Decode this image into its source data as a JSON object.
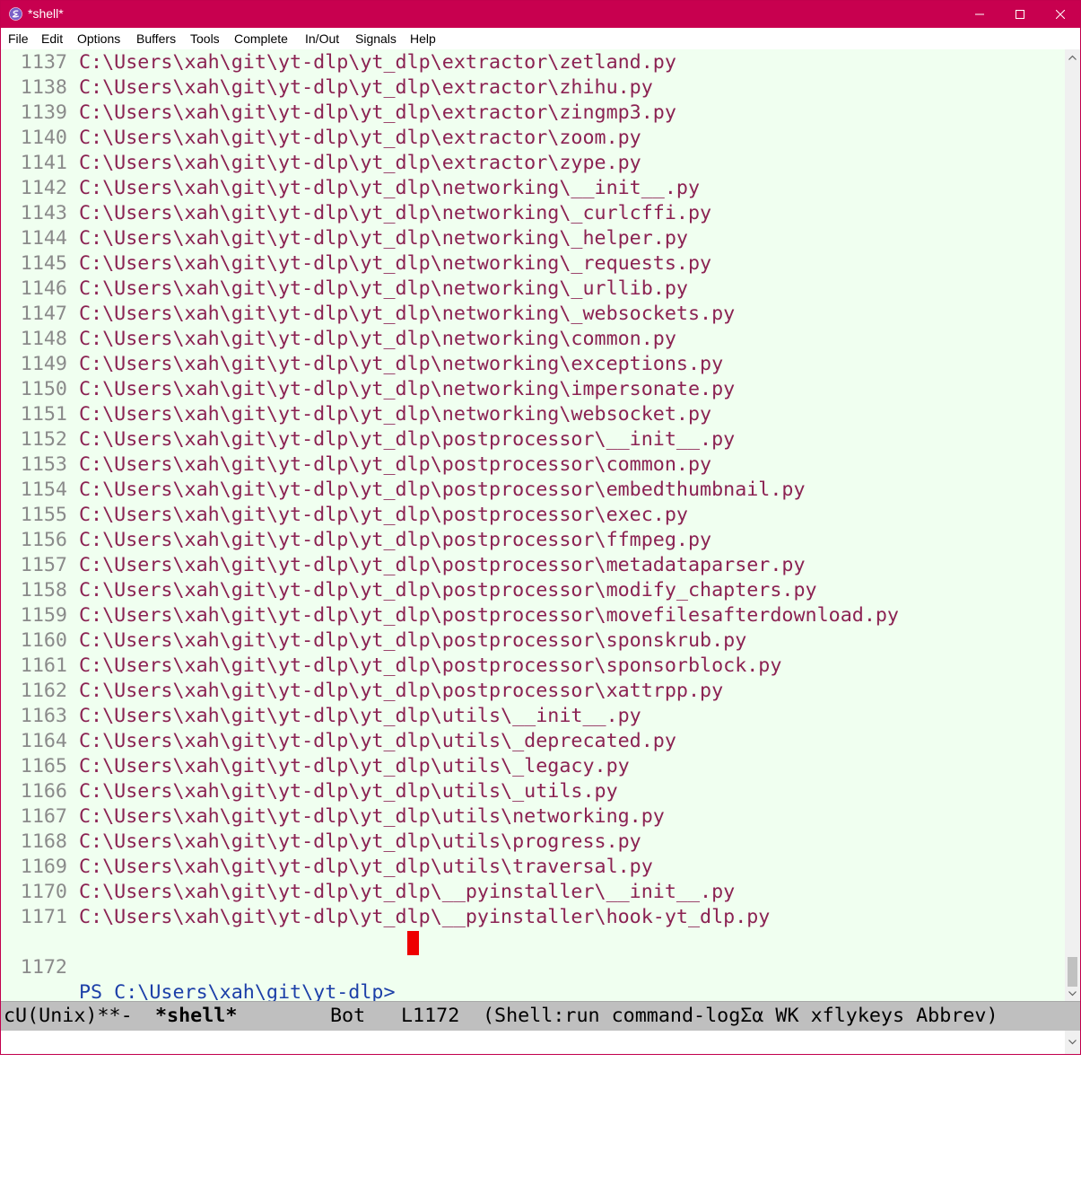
{
  "window": {
    "title": "*shell*",
    "accent": "#c8004f"
  },
  "menu": [
    "File",
    "Edit",
    "Options",
    "Buffers",
    "Tools",
    "Complete",
    "In/Out",
    "Signals",
    "Help"
  ],
  "buffer": {
    "lines": [
      {
        "n": "1137",
        "text": "C:\\Users\\xah\\git\\yt-dlp\\yt_dlp\\extractor\\zetland.py"
      },
      {
        "n": "1138",
        "text": "C:\\Users\\xah\\git\\yt-dlp\\yt_dlp\\extractor\\zhihu.py"
      },
      {
        "n": "1139",
        "text": "C:\\Users\\xah\\git\\yt-dlp\\yt_dlp\\extractor\\zingmp3.py"
      },
      {
        "n": "1140",
        "text": "C:\\Users\\xah\\git\\yt-dlp\\yt_dlp\\extractor\\zoom.py"
      },
      {
        "n": "1141",
        "text": "C:\\Users\\xah\\git\\yt-dlp\\yt_dlp\\extractor\\zype.py"
      },
      {
        "n": "1142",
        "text": "C:\\Users\\xah\\git\\yt-dlp\\yt_dlp\\networking\\__init__.py"
      },
      {
        "n": "1143",
        "text": "C:\\Users\\xah\\git\\yt-dlp\\yt_dlp\\networking\\_curlcffi.py"
      },
      {
        "n": "1144",
        "text": "C:\\Users\\xah\\git\\yt-dlp\\yt_dlp\\networking\\_helper.py"
      },
      {
        "n": "1145",
        "text": "C:\\Users\\xah\\git\\yt-dlp\\yt_dlp\\networking\\_requests.py"
      },
      {
        "n": "1146",
        "text": "C:\\Users\\xah\\git\\yt-dlp\\yt_dlp\\networking\\_urllib.py"
      },
      {
        "n": "1147",
        "text": "C:\\Users\\xah\\git\\yt-dlp\\yt_dlp\\networking\\_websockets.py"
      },
      {
        "n": "1148",
        "text": "C:\\Users\\xah\\git\\yt-dlp\\yt_dlp\\networking\\common.py"
      },
      {
        "n": "1149",
        "text": "C:\\Users\\xah\\git\\yt-dlp\\yt_dlp\\networking\\exceptions.py"
      },
      {
        "n": "1150",
        "text": "C:\\Users\\xah\\git\\yt-dlp\\yt_dlp\\networking\\impersonate.py"
      },
      {
        "n": "1151",
        "text": "C:\\Users\\xah\\git\\yt-dlp\\yt_dlp\\networking\\websocket.py"
      },
      {
        "n": "1152",
        "text": "C:\\Users\\xah\\git\\yt-dlp\\yt_dlp\\postprocessor\\__init__.py"
      },
      {
        "n": "1153",
        "text": "C:\\Users\\xah\\git\\yt-dlp\\yt_dlp\\postprocessor\\common.py"
      },
      {
        "n": "1154",
        "text": "C:\\Users\\xah\\git\\yt-dlp\\yt_dlp\\postprocessor\\embedthumbnail.py"
      },
      {
        "n": "1155",
        "text": "C:\\Users\\xah\\git\\yt-dlp\\yt_dlp\\postprocessor\\exec.py"
      },
      {
        "n": "1156",
        "text": "C:\\Users\\xah\\git\\yt-dlp\\yt_dlp\\postprocessor\\ffmpeg.py"
      },
      {
        "n": "1157",
        "text": "C:\\Users\\xah\\git\\yt-dlp\\yt_dlp\\postprocessor\\metadataparser.py"
      },
      {
        "n": "1158",
        "text": "C:\\Users\\xah\\git\\yt-dlp\\yt_dlp\\postprocessor\\modify_chapters.py"
      },
      {
        "n": "1159",
        "text": "C:\\Users\\xah\\git\\yt-dlp\\yt_dlp\\postprocessor\\movefilesafterdownload.py"
      },
      {
        "n": "1160",
        "text": "C:\\Users\\xah\\git\\yt-dlp\\yt_dlp\\postprocessor\\sponskrub.py"
      },
      {
        "n": "1161",
        "text": "C:\\Users\\xah\\git\\yt-dlp\\yt_dlp\\postprocessor\\sponsorblock.py"
      },
      {
        "n": "1162",
        "text": "C:\\Users\\xah\\git\\yt-dlp\\yt_dlp\\postprocessor\\xattrpp.py"
      },
      {
        "n": "1163",
        "text": "C:\\Users\\xah\\git\\yt-dlp\\yt_dlp\\utils\\__init__.py"
      },
      {
        "n": "1164",
        "text": "C:\\Users\\xah\\git\\yt-dlp\\yt_dlp\\utils\\_deprecated.py"
      },
      {
        "n": "1165",
        "text": "C:\\Users\\xah\\git\\yt-dlp\\yt_dlp\\utils\\_legacy.py"
      },
      {
        "n": "1166",
        "text": "C:\\Users\\xah\\git\\yt-dlp\\yt_dlp\\utils\\_utils.py"
      },
      {
        "n": "1167",
        "text": "C:\\Users\\xah\\git\\yt-dlp\\yt_dlp\\utils\\networking.py"
      },
      {
        "n": "1168",
        "text": "C:\\Users\\xah\\git\\yt-dlp\\yt_dlp\\utils\\progress.py"
      },
      {
        "n": "1169",
        "text": "C:\\Users\\xah\\git\\yt-dlp\\yt_dlp\\utils\\traversal.py"
      },
      {
        "n": "1170",
        "text": "C:\\Users\\xah\\git\\yt-dlp\\yt_dlp\\__pyinstaller\\__init__.py"
      },
      {
        "n": "1171",
        "text": "C:\\Users\\xah\\git\\yt-dlp\\yt_dlp\\__pyinstaller\\hook-yt_dlp.py"
      }
    ],
    "prompt_line": {
      "n": "1172",
      "text": "PS C:\\Users\\xah\\git\\yt-dlp>"
    }
  },
  "modeline": {
    "status": "cU(Unix)**-",
    "buffer_name": "*shell*",
    "position": "Bot",
    "line": "L1172",
    "modes": "(Shell:run command-logΣα WK xflykeys Abbrev)"
  },
  "colors": {
    "path_text": "#8b2252",
    "prompt_text": "#1c3fa8",
    "line_number": "#8a8a8a",
    "background": "#f0fff0",
    "cursor": "#ee0000",
    "modeline_bg": "#bfbfbf"
  }
}
